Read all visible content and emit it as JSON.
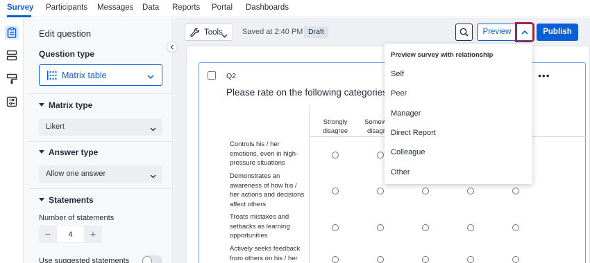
{
  "nav": {
    "tabs": [
      "Survey",
      "Participants",
      "Messages",
      "Data",
      "Reports",
      "Portal",
      "Dashboards"
    ],
    "active": "Survey"
  },
  "rail": {
    "icons": [
      "survey-flow-icon",
      "layout-icon",
      "paintbrush-icon",
      "options-icon"
    ]
  },
  "panel": {
    "title": "Edit question",
    "question_type_label": "Question type",
    "question_type_value": "Matrix table",
    "matrix_type_label": "Matrix type",
    "matrix_type_value": "Likert",
    "answer_type_label": "Answer type",
    "answer_type_value": "Allow one answer",
    "statements_label": "Statements",
    "num_statements_label": "Number of statements",
    "num_statements_value": "4",
    "minus": "−",
    "plus": "+",
    "suggested_label": "Use suggested statements"
  },
  "toolbar": {
    "tools_label": "Tools",
    "saved_text": "Saved at 2:40 PM",
    "draft_badge": "Draft",
    "preview_label": "Preview",
    "publish_label": "Publish"
  },
  "question": {
    "id": "Q2",
    "text": "Please rate  on the following categories f",
    "more": "•••",
    "columns": [
      "Strongly disagree",
      "Somewhat disagree"
    ],
    "column_lines": [
      [
        "Strongly",
        "disagree"
      ],
      [
        "Somew",
        "disagr"
      ]
    ],
    "statements": [
      "Controls his / her emotions, even in high-pressure situations",
      "Demonstrates an awareness of how his / her actions and decisions affect others",
      "Treats mistakes and setbacks as learning opportunities",
      "Actively seeks feedback from others on his / her"
    ]
  },
  "preview_menu": {
    "header": "Preview survey with relationship",
    "items": [
      "Self",
      "Peer",
      "Manager",
      "Direct Report",
      "Colleague",
      "Other"
    ]
  },
  "colors": {
    "accent": "#0b5fd4",
    "highlight": "#c0152a"
  }
}
